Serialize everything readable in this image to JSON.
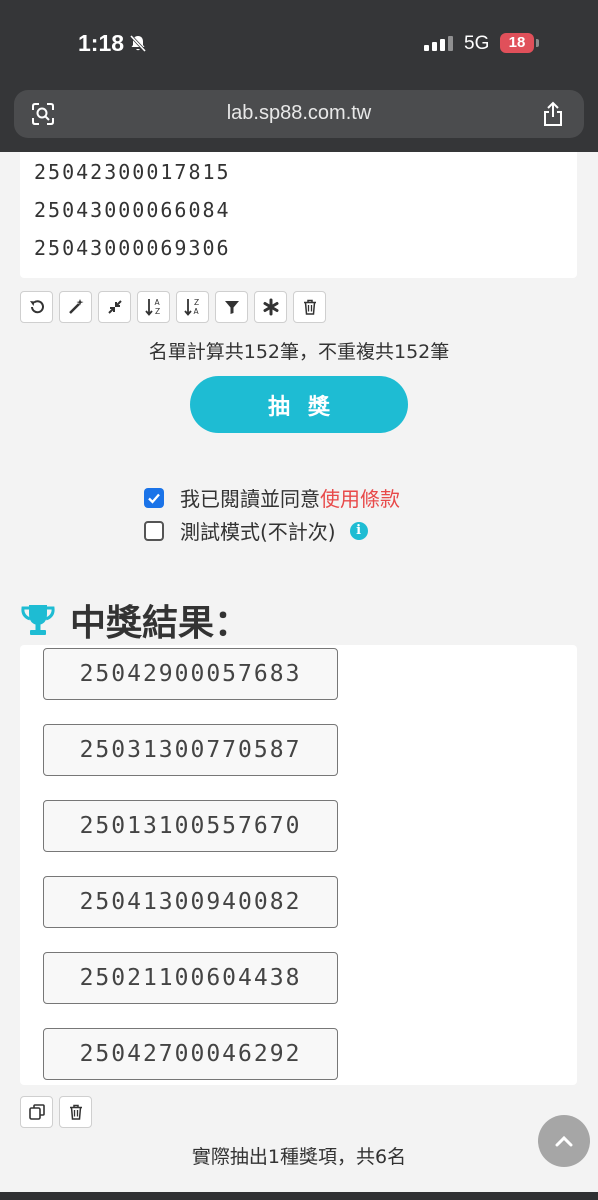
{
  "status_bar": {
    "time": "1:18",
    "network": "5G",
    "battery": "18"
  },
  "browser": {
    "url": "lab.sp88.com.tw"
  },
  "list": {
    "visible_lines": [
      "25042300017815",
      "25043000066084",
      "25043000069306"
    ]
  },
  "toolbar": {
    "icons": [
      "undo-icon",
      "magic-wand-icon",
      "collapse-icon",
      "sort-asc-icon",
      "sort-desc-icon",
      "filter-icon",
      "asterisk-icon",
      "trash-icon"
    ]
  },
  "count_text": "名單計算共152筆，不重複共152筆",
  "draw_button_label": "抽獎",
  "options": {
    "agree_prefix": "我已閱讀並同意",
    "agree_link": "使用條款",
    "agree_checked": true,
    "test_mode_label": "測試模式(不計次)",
    "test_mode_checked": false
  },
  "results": {
    "title": "中獎結果：",
    "winners": [
      "25042900057683",
      "25031300770587",
      "25013100557670",
      "25041300940082",
      "25021100604438",
      "25042700046292"
    ]
  },
  "summary_text": "實際抽出1種獎項，共6名",
  "colors": {
    "accent": "#1ebcd3",
    "link": "#e84a4a",
    "checkbox": "#1a73e8"
  }
}
